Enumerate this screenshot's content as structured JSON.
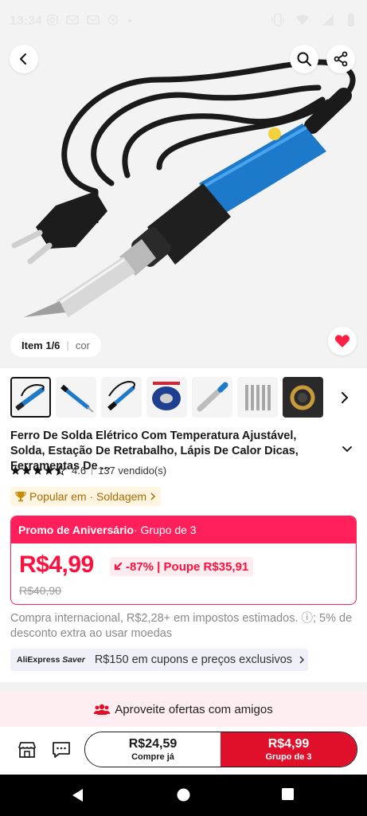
{
  "status_bar": {
    "time": "13:34"
  },
  "hero": {
    "item_counter": "Item 1/6",
    "item_variant": "cor"
  },
  "thumbnails": [
    {
      "name": "soldering-iron-blue"
    },
    {
      "name": "soldering-iron-tips"
    },
    {
      "name": "soldering-iron-angle"
    },
    {
      "name": "solder-wire-spool"
    },
    {
      "name": "desoldering-pump"
    },
    {
      "name": "tip-set"
    },
    {
      "name": "wire-coil"
    }
  ],
  "product": {
    "title": "Ferro De Solda Elétrico Com Temperatura Ajustável, Solda, Estação De Retrabalho, Lápis De Calor Dicas, Ferramentas De ...",
    "rating": "4.6",
    "sold": "137 vendido(s)",
    "popular": "Popular em · Soldagem"
  },
  "promo": {
    "label": "Promo de Aniversário",
    "group": " · Grupo de 3",
    "price": "R$4,99",
    "discount": "-87% | Poupe R$35,91",
    "old_price": "R$40,90"
  },
  "tax_note": "Compra internacional, R$2,28+ em impostos estimados. ⓘ; 5% de desconto extra ao usar moedas",
  "saver": {
    "brand_a": "AliExpress",
    "brand_b": "Saver",
    "text": "R$150 em cupons e preços exclusivos"
  },
  "share_band": "Aproveite ofertas com amigos",
  "buy": {
    "left_price": "R$24,59",
    "left_label": "Compre já",
    "right_price": "R$4,99",
    "right_label": "Grupo de 3"
  },
  "colors": {
    "accent": "#ff1f5a",
    "price": "#ff0f3d",
    "buy_group": "#e0102b",
    "popular_text": "#a86a00"
  },
  "icons": [
    "back-icon",
    "search-icon",
    "share-icon",
    "heart-icon",
    "chevron-right-icon",
    "store-icon",
    "chat-icon",
    "group-icon"
  ]
}
